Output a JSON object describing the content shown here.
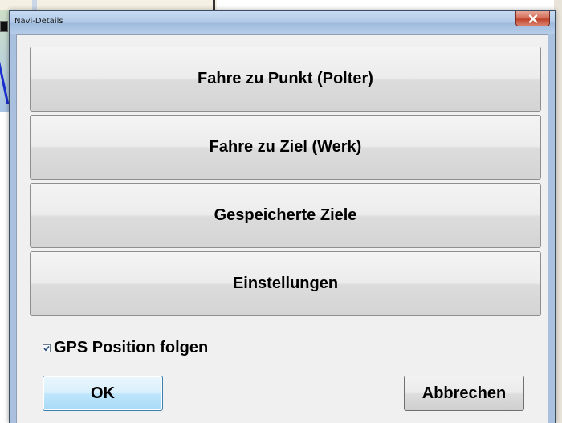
{
  "window": {
    "title": "Navi-Details"
  },
  "actions": [
    {
      "label": "Fahre zu Punkt (Polter)"
    },
    {
      "label": "Fahre zu Ziel (Werk)"
    },
    {
      "label": "Gespeicherte Ziele"
    },
    {
      "label": "Einstellungen"
    }
  ],
  "gps_follow": {
    "label": "GPS Position folgen",
    "checked": true
  },
  "footer": {
    "ok_label": "OK",
    "cancel_label": "Abbrechen"
  },
  "colors": {
    "close_button": "#c0442c",
    "ok_button_accent": "#bee6fd",
    "dialog_background": "#f0f0f0"
  }
}
